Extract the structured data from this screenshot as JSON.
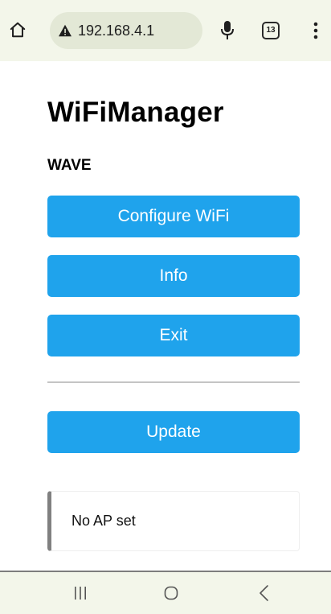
{
  "browser": {
    "url": "192.168.4.1",
    "tab_count": "13",
    "icons": {
      "home": "home-icon",
      "security": "warning-triangle-icon",
      "voice": "microphone-icon",
      "tabs": "tabs-icon",
      "menu": "more-vert-icon"
    }
  },
  "page": {
    "title": "WiFiManager",
    "device_name": "WAVE",
    "buttons": {
      "configure": "Configure WiFi",
      "info": "Info",
      "exit": "Exit",
      "update": "Update"
    },
    "status_message": "No AP set"
  },
  "system_nav": {
    "icons": [
      "recent-apps-icon",
      "home-circle-icon",
      "back-icon"
    ]
  },
  "colors": {
    "button_bg": "#1fa3ec",
    "button_text": "#ffffff",
    "browser_bar_bg": "#f3f6ea",
    "url_pill_bg": "#e3e8d6",
    "message_border": "#808080"
  }
}
